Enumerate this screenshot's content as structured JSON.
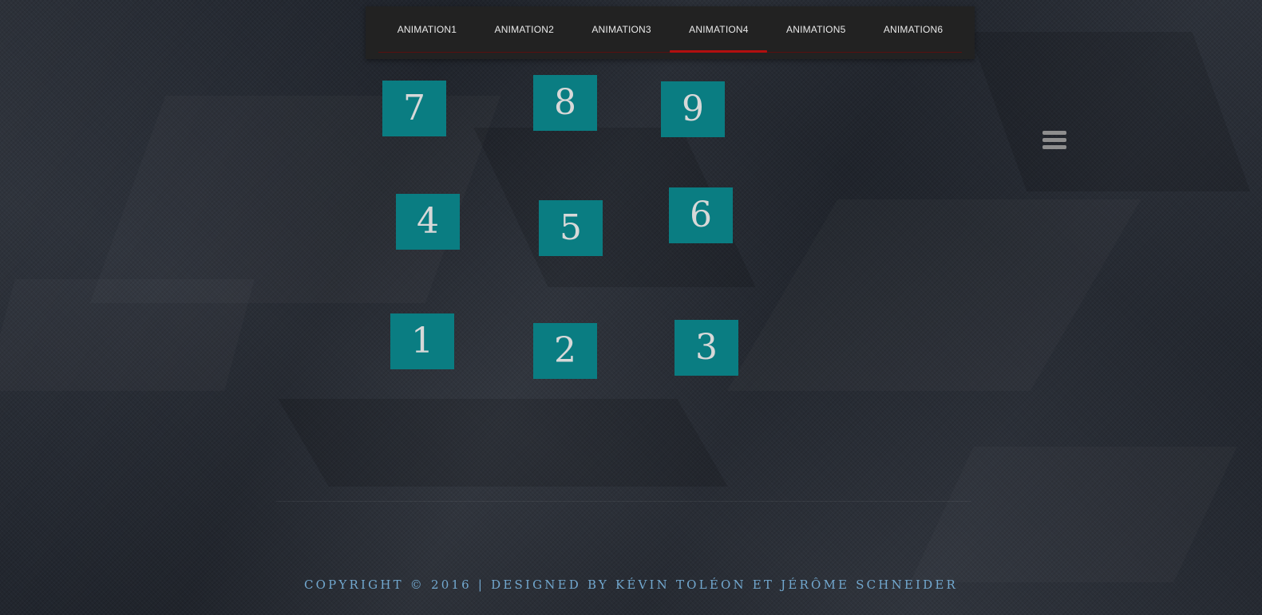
{
  "nav": {
    "items": [
      {
        "label": "ANIMATION1"
      },
      {
        "label": "ANIMATION2"
      },
      {
        "label": "ANIMATION3"
      },
      {
        "label": "ANIMATION4",
        "active": true
      },
      {
        "label": "ANIMATION5"
      },
      {
        "label": "ANIMATION6"
      }
    ]
  },
  "tiles": [
    "7",
    "8",
    "9",
    "4",
    "5",
    "6",
    "1",
    "2",
    "3"
  ],
  "menu": {
    "icon": "hamburger-menu-icon"
  },
  "footer": {
    "text": "COPYRIGHT © 2016 | DESIGNED BY KÉVIN TOLÉON ET JÉRÔME SCHNEIDER"
  },
  "colors": {
    "background": "#252a33",
    "nav_background": "#222222",
    "nav_active_underline": "#b30f0f",
    "tile": "#0a7d82",
    "footer_text": "#72a8cf"
  }
}
